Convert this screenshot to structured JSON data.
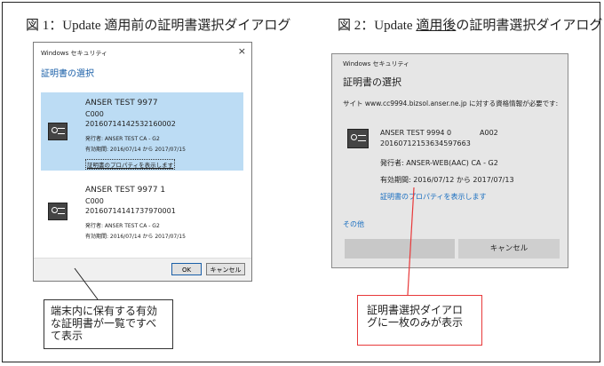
{
  "figure1": {
    "caption": "図 1：Update 適用前の証明書選択ダイアログ",
    "dialog": {
      "window_title": "Windows セキュリティ",
      "close_glyph": "×",
      "heading": "証明書の選択",
      "certificates": [
        {
          "name": "ANSER TEST 9977",
          "line2": "C000",
          "serial": "20160714142532160002",
          "issuer": "発行者: ANSER TEST CA - G2",
          "validity": "有効期間: 2016/07/14 から 2017/07/15",
          "properties_link": "証明書のプロパティを表示します"
        },
        {
          "name": "ANSER TEST 9977 1",
          "line2": "C000",
          "serial": "20160714141737970001",
          "issuer": "発行者: ANSER TEST CA - G2",
          "validity": "有効期間: 2016/07/14 から 2017/07/15"
        }
      ],
      "ok_label": "OK",
      "cancel_label": "キャンセル"
    },
    "callout": "端末内に保有する有効な証明書が一覧ですべて表示"
  },
  "figure2": {
    "caption_prefix": "図 2：Update ",
    "caption_emphasis": "適用後",
    "caption_suffix": "の証明書選択ダイアログ",
    "dialog": {
      "window_title": "Windows セキュリティ",
      "heading": "証明書の選択",
      "site_message": "サイト www.cc9994.bizsol.anser.ne.jp に対する資格情報が必要です:",
      "cert_name": "ANSER TEST 9994 0",
      "cert_code": "A002",
      "serial": "20160712153634597663",
      "issuer": "発行者: ANSER-WEB(AAC) CA - G2",
      "validity": "有効期間: 2016/07/12 から 2017/07/13",
      "properties_link": "証明書のプロパティを表示します",
      "other_link": "その他",
      "ok_label": "",
      "cancel_label": "キャンセル"
    },
    "callout": "証明書選択ダイアログに一枚のみが表示"
  }
}
